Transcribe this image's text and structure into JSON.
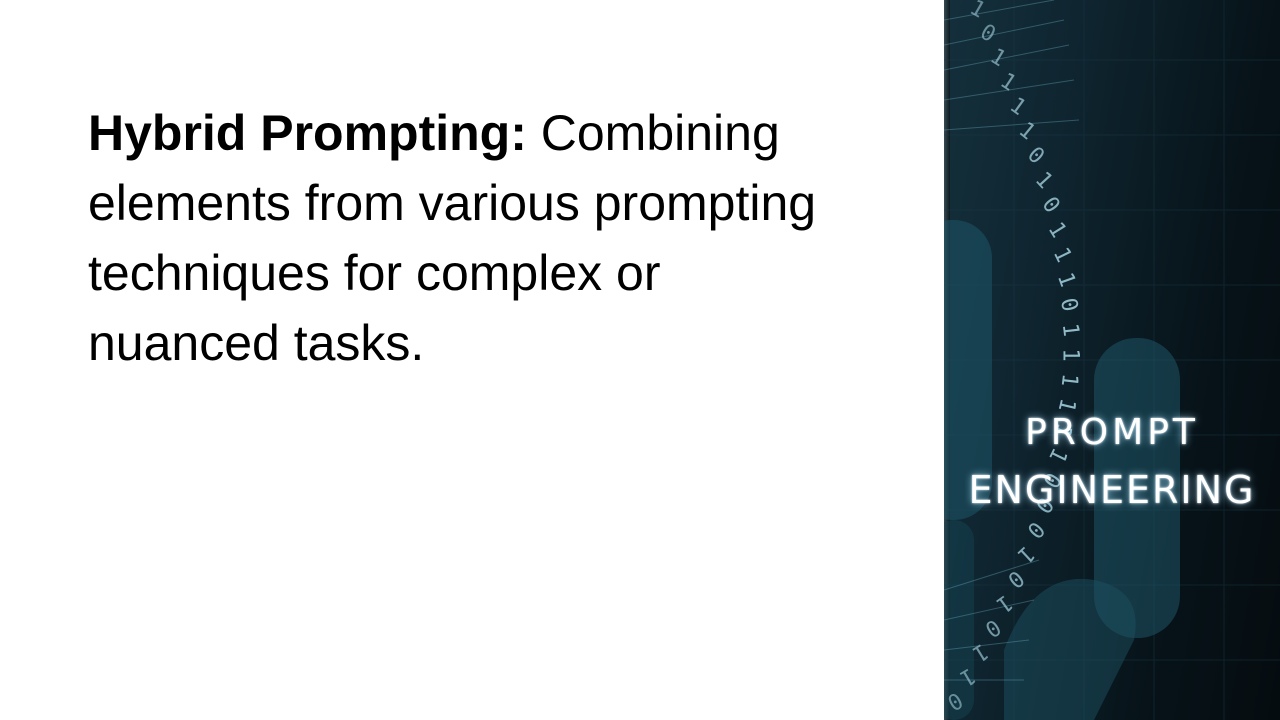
{
  "slide": {
    "term": "Hybrid Prompting:",
    "description": " Combining elements from various prompting techniques for complex or nuanced tasks."
  },
  "side_panel": {
    "title_line1": "PROMPT",
    "title_line2": "ENGINEERING",
    "binary_digits": "10111101011101111110001010110",
    "colors": {
      "background": "#0b1c24",
      "glow": "#aee1ff",
      "shape": "#1d5567"
    }
  }
}
